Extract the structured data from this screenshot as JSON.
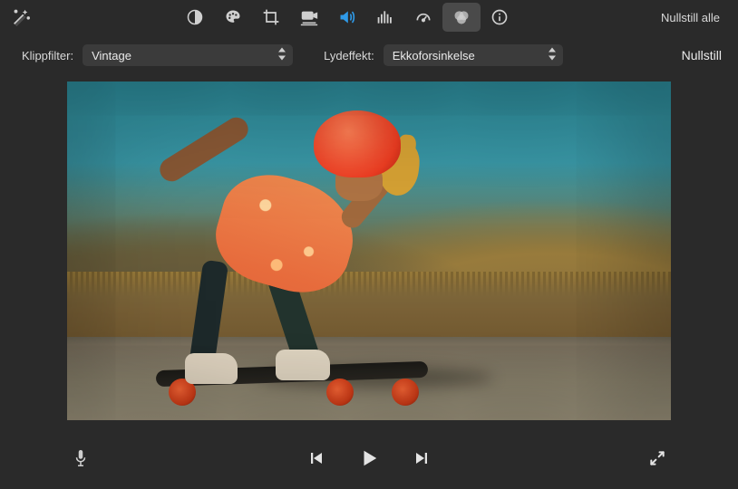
{
  "toolbar": {
    "reset_all_label": "Nullstill alle"
  },
  "controls": {
    "clip_filter_label": "Klippfilter:",
    "clip_filter_value": "Vintage",
    "audio_effect_label": "Lydeffekt:",
    "audio_effect_value": "Ekkoforsinkelse",
    "reset_label": "Nullstill"
  },
  "icons": {
    "magic_wand": "magic-wand-icon",
    "contrast": "contrast-icon",
    "palette": "palette-icon",
    "crop": "crop-icon",
    "camera": "camera-stabilize-icon",
    "volume": "volume-icon",
    "equalizer": "equalizer-icon",
    "speed": "speed-icon",
    "filter": "filter-effects-icon",
    "info": "info-icon",
    "mic": "microphone-icon",
    "prev": "previous-icon",
    "play": "play-icon",
    "next": "next-icon",
    "expand": "expand-icon",
    "chevron": "chevron-up-down-icon"
  }
}
